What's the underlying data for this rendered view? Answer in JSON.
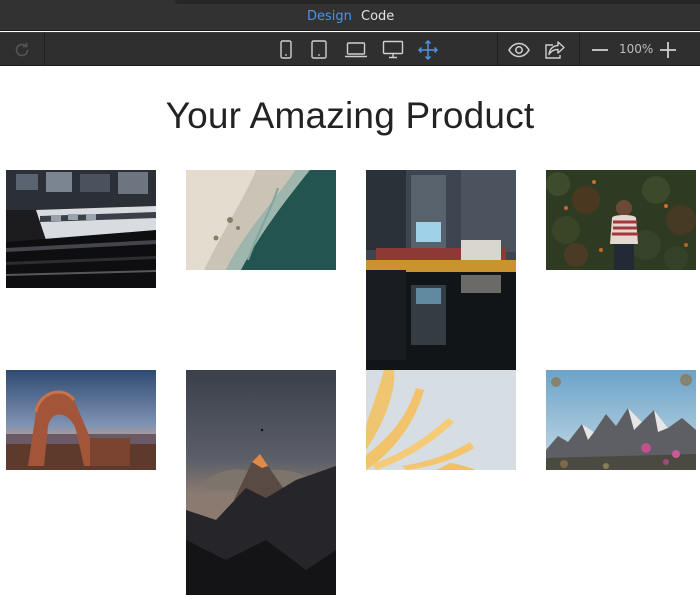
{
  "mode_tabs": [
    {
      "label": "Design",
      "active": true
    },
    {
      "label": "Code",
      "active": false
    }
  ],
  "toolbar": {
    "icons": [
      "refresh-icon",
      "phone-icon",
      "tablet-icon",
      "laptop-icon",
      "desktop-icon",
      "move-icon",
      "eye-icon",
      "share-icon",
      "zoom-out-icon",
      "zoom-in-icon"
    ],
    "active_device": "move-icon",
    "zoom_level": "100%"
  },
  "page": {
    "title": "Your Amazing Product"
  },
  "gallery": {
    "images": [
      {
        "subject": "elevated train"
      },
      {
        "subject": "aerial beach"
      },
      {
        "subject": "city street reflection"
      },
      {
        "subject": "woman in front of ivy wall"
      },
      {
        "subject": "desert rock arch"
      },
      {
        "subject": "mountain peak at dusk"
      },
      {
        "subject": "yellow petals"
      },
      {
        "subject": "mountain ridge with flowers"
      }
    ]
  },
  "colors": {
    "chrome_bg": "#323232",
    "toolbar_bg": "#2f2f2f",
    "accent": "#4f93e6",
    "title_text": "#222222"
  }
}
